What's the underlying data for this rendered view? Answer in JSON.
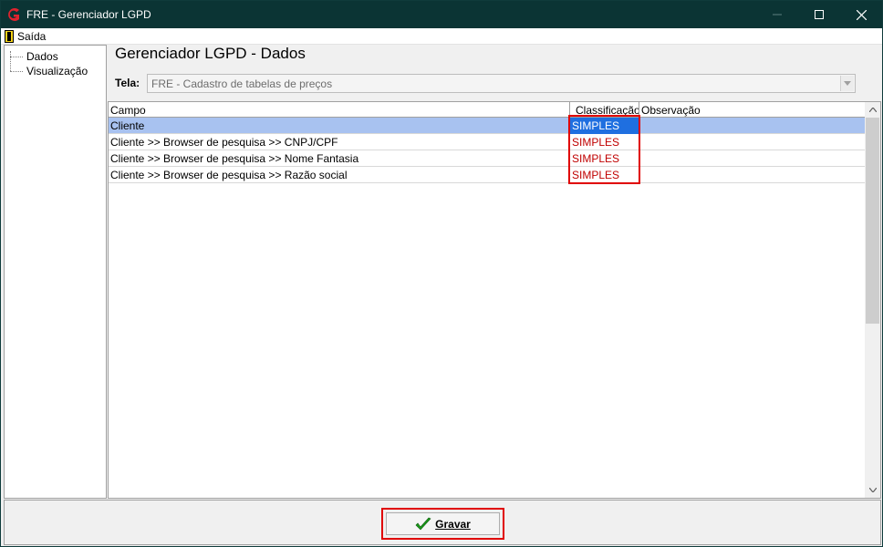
{
  "window": {
    "title": "FRE - Gerenciador LGPD",
    "controls": {
      "minimize": "—",
      "maximize": "☐",
      "close": "✕"
    }
  },
  "menu": {
    "exit_label": "Saída"
  },
  "tree": {
    "items": [
      {
        "label": "Dados"
      },
      {
        "label": "Visualização"
      }
    ]
  },
  "main": {
    "title": "Gerenciador LGPD - Dados",
    "tela_label": "Tela:",
    "tela_value": "FRE - Cadastro de tabelas de preços"
  },
  "grid": {
    "columns": [
      "Campo",
      "Classificação",
      "Observação"
    ],
    "rows": [
      {
        "campo": "Cliente",
        "classificacao": "SIMPLES",
        "observacao": "",
        "selected": true
      },
      {
        "campo": "Cliente >> Browser de pesquisa >> CNPJ/CPF",
        "classificacao": "SIMPLES",
        "observacao": ""
      },
      {
        "campo": "Cliente >> Browser de pesquisa >> Nome Fantasia",
        "classificacao": "SIMPLES",
        "observacao": ""
      },
      {
        "campo": "Cliente >> Browser de pesquisa >> Razão social",
        "classificacao": "SIMPLES",
        "observacao": ""
      }
    ]
  },
  "footer": {
    "save_label": "Gravar"
  },
  "colors": {
    "titlebar": "#0b3434",
    "selection": "#a8c2f0",
    "cell_selected": "#1f6fe0",
    "classification_text": "#c00000",
    "highlight": "#e00000"
  }
}
